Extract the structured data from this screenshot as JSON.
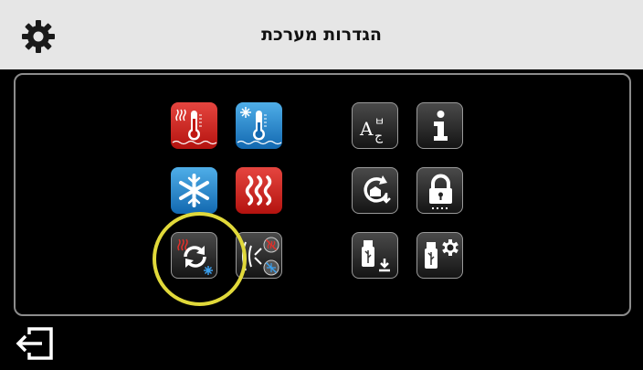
{
  "header": {
    "title": "הגדרות מערכת",
    "settings_icon": "gear-icon"
  },
  "tiles": [
    {
      "name": "heating-temperature-button",
      "icon": "thermometer-heat-icon",
      "color": "#cf2b25"
    },
    {
      "name": "cooling-temperature-button",
      "icon": "thermometer-snow-icon",
      "color": "#2a86cf"
    },
    {
      "name": "cooling-mode-button",
      "icon": "snowflake-icon",
      "color": "#2a86cf"
    },
    {
      "name": "heating-mode-button",
      "icon": "heat-waves-icon",
      "color": "#cf2b25"
    },
    {
      "name": "auto-changeover-button",
      "icon": "changeover-cycle-icon",
      "selected": true
    },
    {
      "name": "mode-lockout-button",
      "icon": "mode-disable-icon"
    },
    {
      "name": "language-button",
      "icon": "language-icon"
    },
    {
      "name": "information-button",
      "icon": "info-icon"
    },
    {
      "name": "restore-settings-button",
      "icon": "restore-icon"
    },
    {
      "name": "lock-button",
      "icon": "lock-icon"
    },
    {
      "name": "usb-download-button",
      "icon": "usb-download-icon"
    },
    {
      "name": "usb-settings-button",
      "icon": "usb-settings-icon"
    }
  ],
  "footer": {
    "exit_icon": "exit-icon"
  },
  "colors": {
    "header_bg": "#e6e6e6",
    "highlight": "#e1d93a",
    "background": "#000000"
  }
}
